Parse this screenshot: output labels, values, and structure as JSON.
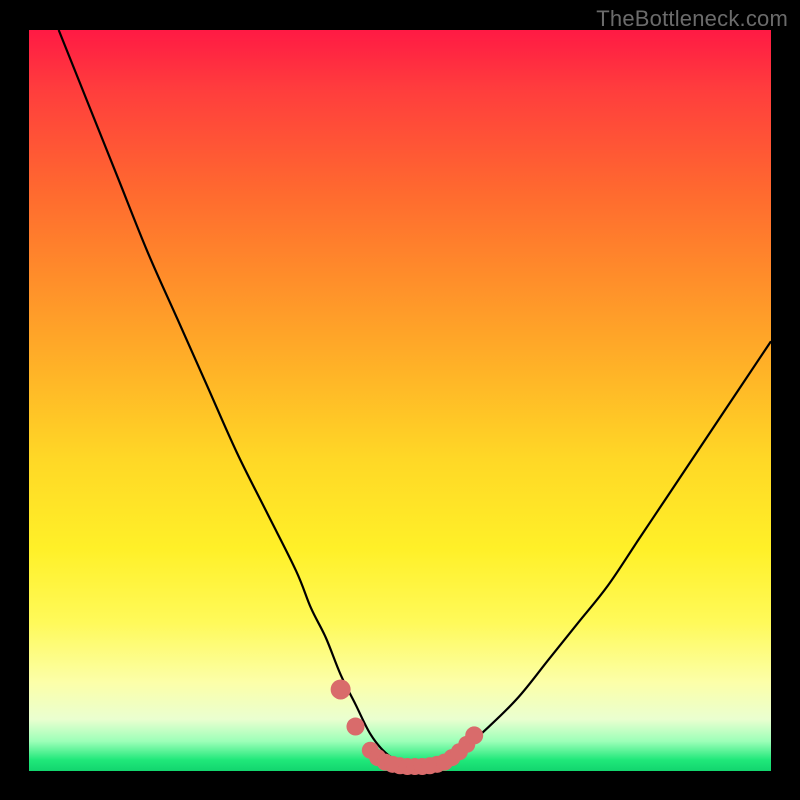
{
  "watermark": "TheBottleneck.com",
  "colors": {
    "frame": "#000000",
    "curve": "#000000",
    "marker_fill": "#d96b6b",
    "marker_stroke": "#c85a5a"
  },
  "chart_data": {
    "type": "line",
    "title": "",
    "xlabel": "",
    "ylabel": "",
    "xlim": [
      0,
      100
    ],
    "ylim": [
      0,
      100
    ],
    "grid": false,
    "legend": false,
    "series": [
      {
        "name": "bottleneck-curve",
        "x": [
          4,
          8,
          12,
          16,
          20,
          24,
          28,
          32,
          36,
          38,
          40,
          42,
          44,
          46,
          48,
          50,
          52,
          54,
          56,
          58,
          62,
          66,
          70,
          74,
          78,
          82,
          86,
          90,
          94,
          98,
          100
        ],
        "y": [
          100,
          90,
          80,
          70,
          61,
          52,
          43,
          35,
          27,
          22,
          18,
          13,
          9,
          5,
          2.5,
          1.2,
          0.7,
          0.7,
          1.2,
          2.5,
          6,
          10,
          15,
          20,
          25,
          31,
          37,
          43,
          49,
          55,
          58
        ]
      }
    ],
    "markers": {
      "name": "valley-markers",
      "x": [
        42,
        44,
        46,
        47,
        48,
        49,
        50,
        51,
        52,
        53,
        54,
        55,
        56,
        57,
        58,
        59,
        60
      ],
      "y": [
        11,
        6,
        2.8,
        1.8,
        1.2,
        0.9,
        0.7,
        0.6,
        0.6,
        0.6,
        0.7,
        0.9,
        1.2,
        1.8,
        2.6,
        3.6,
        4.8
      ]
    }
  }
}
